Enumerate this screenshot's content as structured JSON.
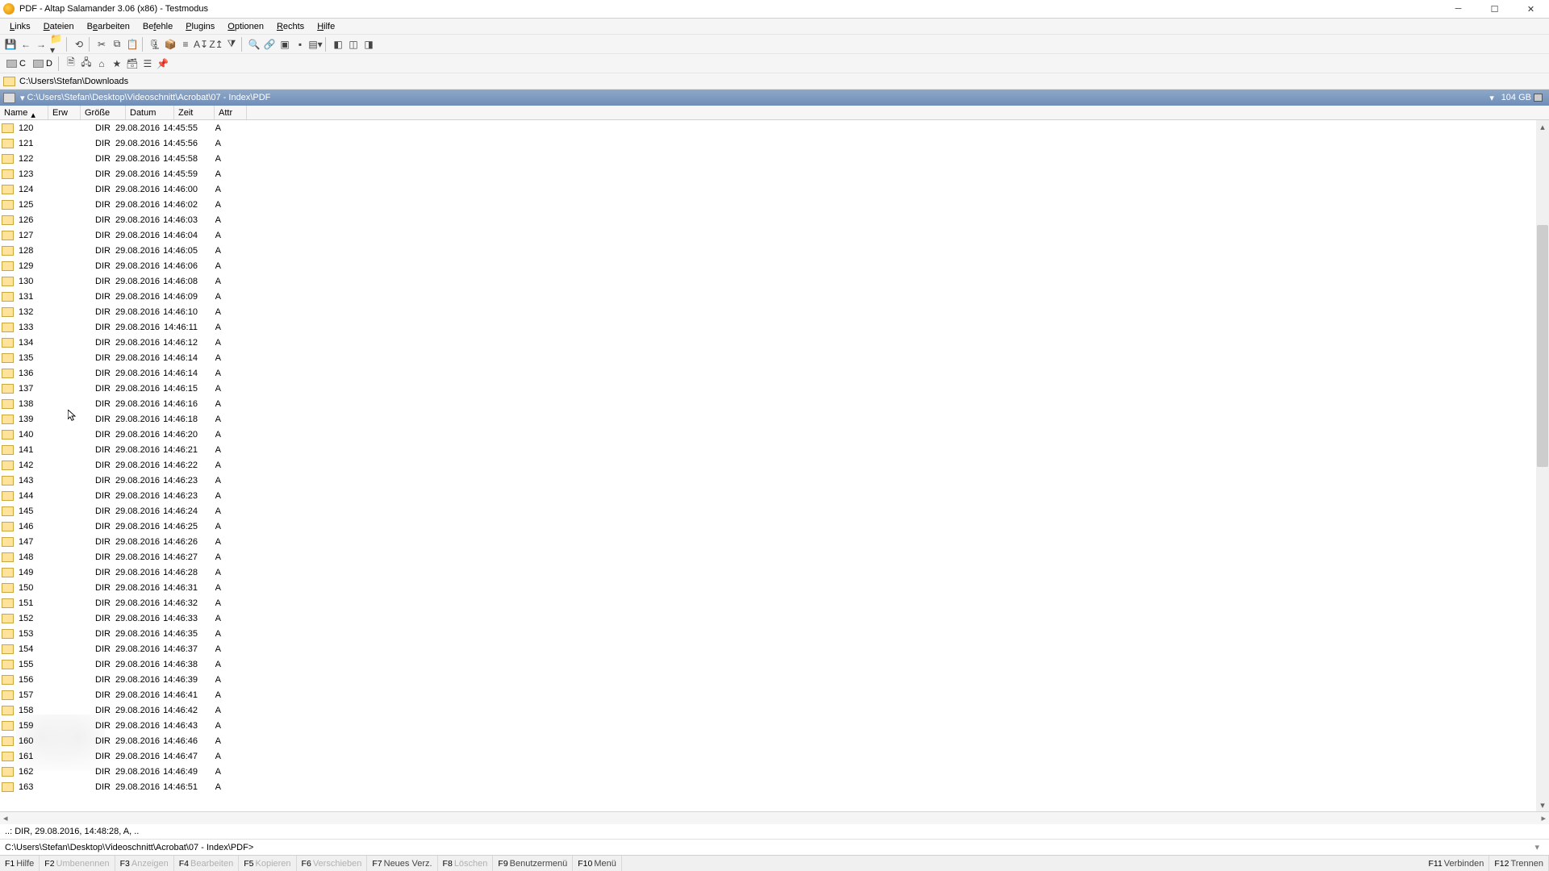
{
  "window": {
    "title": "PDF - Altap Salamander 3.06 (x86) - Testmodus"
  },
  "menu": {
    "links": "Links",
    "dateien": "Dateien",
    "bearbeiten": "Bearbeiten",
    "befehle": "Befehle",
    "plugins": "Plugins",
    "optionen": "Optionen",
    "rechts": "Rechts",
    "hilfe": "Hilfe"
  },
  "drives": {
    "c": "C",
    "d": "D"
  },
  "inactive_path": "C:\\Users\\Stefan\\Downloads",
  "active_path": {
    "text": "C:\\Users\\Stefan\\Desktop\\Videoschnitt\\Acrobat\\07 - Index\\PDF",
    "free": "104 GB"
  },
  "columns": {
    "name": "Name",
    "ext": "Erw",
    "size": "Größe",
    "date": "Datum",
    "time": "Zeit",
    "attr": "Attr"
  },
  "rows": [
    {
      "name": "120",
      "size": "DIR",
      "date": "29.08.2016",
      "time": "14:45:55",
      "attr": "A"
    },
    {
      "name": "121",
      "size": "DIR",
      "date": "29.08.2016",
      "time": "14:45:56",
      "attr": "A"
    },
    {
      "name": "122",
      "size": "DIR",
      "date": "29.08.2016",
      "time": "14:45:58",
      "attr": "A"
    },
    {
      "name": "123",
      "size": "DIR",
      "date": "29.08.2016",
      "time": "14:45:59",
      "attr": "A"
    },
    {
      "name": "124",
      "size": "DIR",
      "date": "29.08.2016",
      "time": "14:46:00",
      "attr": "A"
    },
    {
      "name": "125",
      "size": "DIR",
      "date": "29.08.2016",
      "time": "14:46:02",
      "attr": "A"
    },
    {
      "name": "126",
      "size": "DIR",
      "date": "29.08.2016",
      "time": "14:46:03",
      "attr": "A"
    },
    {
      "name": "127",
      "size": "DIR",
      "date": "29.08.2016",
      "time": "14:46:04",
      "attr": "A"
    },
    {
      "name": "128",
      "size": "DIR",
      "date": "29.08.2016",
      "time": "14:46:05",
      "attr": "A"
    },
    {
      "name": "129",
      "size": "DIR",
      "date": "29.08.2016",
      "time": "14:46:06",
      "attr": "A"
    },
    {
      "name": "130",
      "size": "DIR",
      "date": "29.08.2016",
      "time": "14:46:08",
      "attr": "A"
    },
    {
      "name": "131",
      "size": "DIR",
      "date": "29.08.2016",
      "time": "14:46:09",
      "attr": "A"
    },
    {
      "name": "132",
      "size": "DIR",
      "date": "29.08.2016",
      "time": "14:46:10",
      "attr": "A"
    },
    {
      "name": "133",
      "size": "DIR",
      "date": "29.08.2016",
      "time": "14:46:11",
      "attr": "A"
    },
    {
      "name": "134",
      "size": "DIR",
      "date": "29.08.2016",
      "time": "14:46:12",
      "attr": "A"
    },
    {
      "name": "135",
      "size": "DIR",
      "date": "29.08.2016",
      "time": "14:46:14",
      "attr": "A"
    },
    {
      "name": "136",
      "size": "DIR",
      "date": "29.08.2016",
      "time": "14:46:14",
      "attr": "A"
    },
    {
      "name": "137",
      "size": "DIR",
      "date": "29.08.2016",
      "time": "14:46:15",
      "attr": "A"
    },
    {
      "name": "138",
      "size": "DIR",
      "date": "29.08.2016",
      "time": "14:46:16",
      "attr": "A"
    },
    {
      "name": "139",
      "size": "DIR",
      "date": "29.08.2016",
      "time": "14:46:18",
      "attr": "A"
    },
    {
      "name": "140",
      "size": "DIR",
      "date": "29.08.2016",
      "time": "14:46:20",
      "attr": "A"
    },
    {
      "name": "141",
      "size": "DIR",
      "date": "29.08.2016",
      "time": "14:46:21",
      "attr": "A"
    },
    {
      "name": "142",
      "size": "DIR",
      "date": "29.08.2016",
      "time": "14:46:22",
      "attr": "A"
    },
    {
      "name": "143",
      "size": "DIR",
      "date": "29.08.2016",
      "time": "14:46:23",
      "attr": "A"
    },
    {
      "name": "144",
      "size": "DIR",
      "date": "29.08.2016",
      "time": "14:46:23",
      "attr": "A"
    },
    {
      "name": "145",
      "size": "DIR",
      "date": "29.08.2016",
      "time": "14:46:24",
      "attr": "A"
    },
    {
      "name": "146",
      "size": "DIR",
      "date": "29.08.2016",
      "time": "14:46:25",
      "attr": "A"
    },
    {
      "name": "147",
      "size": "DIR",
      "date": "29.08.2016",
      "time": "14:46:26",
      "attr": "A"
    },
    {
      "name": "148",
      "size": "DIR",
      "date": "29.08.2016",
      "time": "14:46:27",
      "attr": "A"
    },
    {
      "name": "149",
      "size": "DIR",
      "date": "29.08.2016",
      "time": "14:46:28",
      "attr": "A"
    },
    {
      "name": "150",
      "size": "DIR",
      "date": "29.08.2016",
      "time": "14:46:31",
      "attr": "A"
    },
    {
      "name": "151",
      "size": "DIR",
      "date": "29.08.2016",
      "time": "14:46:32",
      "attr": "A"
    },
    {
      "name": "152",
      "size": "DIR",
      "date": "29.08.2016",
      "time": "14:46:33",
      "attr": "A"
    },
    {
      "name": "153",
      "size": "DIR",
      "date": "29.08.2016",
      "time": "14:46:35",
      "attr": "A"
    },
    {
      "name": "154",
      "size": "DIR",
      "date": "29.08.2016",
      "time": "14:46:37",
      "attr": "A"
    },
    {
      "name": "155",
      "size": "DIR",
      "date": "29.08.2016",
      "time": "14:46:38",
      "attr": "A"
    },
    {
      "name": "156",
      "size": "DIR",
      "date": "29.08.2016",
      "time": "14:46:39",
      "attr": "A"
    },
    {
      "name": "157",
      "size": "DIR",
      "date": "29.08.2016",
      "time": "14:46:41",
      "attr": "A"
    },
    {
      "name": "158",
      "size": "DIR",
      "date": "29.08.2016",
      "time": "14:46:42",
      "attr": "A"
    },
    {
      "name": "159",
      "size": "DIR",
      "date": "29.08.2016",
      "time": "14:46:43",
      "attr": "A"
    },
    {
      "name": "160",
      "size": "DIR",
      "date": "29.08.2016",
      "time": "14:46:46",
      "attr": "A"
    },
    {
      "name": "161",
      "size": "DIR",
      "date": "29.08.2016",
      "time": "14:46:47",
      "attr": "A"
    },
    {
      "name": "162",
      "size": "DIR",
      "date": "29.08.2016",
      "time": "14:46:49",
      "attr": "A"
    },
    {
      "name": "163",
      "size": "DIR",
      "date": "29.08.2016",
      "time": "14:46:51",
      "attr": "A"
    }
  ],
  "info_line": "..: DIR, 29.08.2016, 14:48:28, A, ..",
  "cmd_line": "C:\\Users\\Stefan\\Desktop\\Videoschnitt\\Acrobat\\07 - Index\\PDF>",
  "fkeys": {
    "f1": {
      "k": "F1",
      "l": "Hilfe"
    },
    "f2": {
      "k": "F2",
      "l": "Umbenennen"
    },
    "f3": {
      "k": "F3",
      "l": "Anzeigen"
    },
    "f4": {
      "k": "F4",
      "l": "Bearbeiten"
    },
    "f5": {
      "k": "F5",
      "l": "Kopieren"
    },
    "f6": {
      "k": "F6",
      "l": "Verschieben"
    },
    "f7": {
      "k": "F7",
      "l": "Neues Verz."
    },
    "f8": {
      "k": "F8",
      "l": "Löschen"
    },
    "f9": {
      "k": "F9",
      "l": "Benutzermenü"
    },
    "f10": {
      "k": "F10",
      "l": "Menü"
    },
    "f11": {
      "k": "F11",
      "l": "Verbinden"
    },
    "f12": {
      "k": "F12",
      "l": "Trennen"
    }
  }
}
